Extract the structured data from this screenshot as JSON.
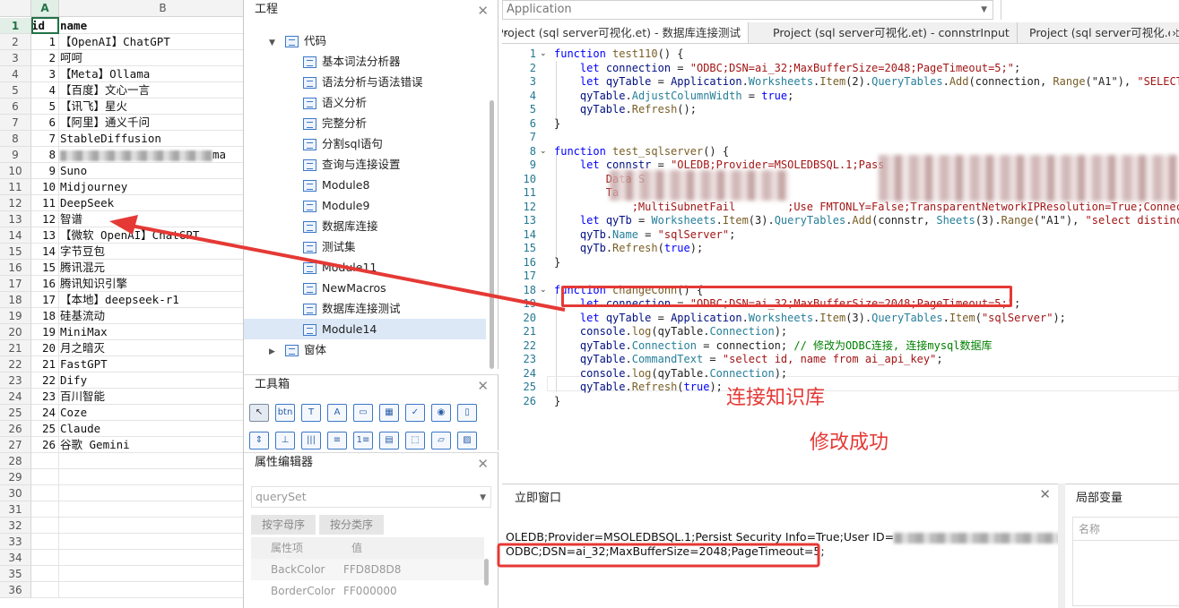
{
  "sheet": {
    "columns": [
      "A",
      "B"
    ],
    "header": {
      "id": "id",
      "name": "name"
    },
    "rows": [
      {
        "id": "1",
        "name": "【OpenAI】ChatGPT"
      },
      {
        "id": "2",
        "name": "呵呵"
      },
      {
        "id": "3",
        "name": "【Meta】Ollama"
      },
      {
        "id": "4",
        "name": "【百度】文心一言"
      },
      {
        "id": "5",
        "name": "【讯飞】星火"
      },
      {
        "id": "6",
        "name": "【阿里】通义千问"
      },
      {
        "id": "7",
        "name": "StableDiffusion"
      },
      {
        "id": "8",
        "name": "ma"
      },
      {
        "id": "9",
        "name": "Suno"
      },
      {
        "id": "10",
        "name": "Midjourney"
      },
      {
        "id": "11",
        "name": "DeepSeek"
      },
      {
        "id": "12",
        "name": "智谱"
      },
      {
        "id": "13",
        "name": "【微软 OpenAI】ChatGPT"
      },
      {
        "id": "14",
        "name": "字节豆包"
      },
      {
        "id": "15",
        "name": "腾讯混元"
      },
      {
        "id": "16",
        "name": "腾讯知识引擎"
      },
      {
        "id": "17",
        "name": "【本地】deepseek-r1"
      },
      {
        "id": "18",
        "name": "硅基流动"
      },
      {
        "id": "19",
        "name": "MiniMax"
      },
      {
        "id": "20",
        "name": "月之暗灭"
      },
      {
        "id": "21",
        "name": "FastGPT"
      },
      {
        "id": "22",
        "name": "Dify"
      },
      {
        "id": "23",
        "name": "百川智能"
      },
      {
        "id": "24",
        "name": "Coze"
      },
      {
        "id": "25",
        "name": "Claude"
      },
      {
        "id": "26",
        "name": "谷歌 Gemini"
      }
    ],
    "row_numbers": [
      "1",
      "2",
      "3",
      "4",
      "5",
      "6",
      "7",
      "8",
      "9",
      "10",
      "11",
      "12",
      "13",
      "14",
      "15",
      "16",
      "17",
      "18",
      "19",
      "20",
      "21",
      "22",
      "23",
      "24",
      "25",
      "26",
      "27",
      "28",
      "29",
      "30",
      "31",
      "32",
      "33",
      "34",
      "35",
      "36"
    ]
  },
  "project": {
    "title": "工程",
    "close": "✕",
    "items": [
      {
        "label": "代码",
        "kind": "folder-open"
      },
      {
        "label": "基本词法分析器",
        "kind": "module"
      },
      {
        "label": "语法分析与语法错误",
        "kind": "module"
      },
      {
        "label": "语义分析",
        "kind": "module"
      },
      {
        "label": "完整分析",
        "kind": "module"
      },
      {
        "label": "分割sql语句",
        "kind": "module"
      },
      {
        "label": "查询与连接设置",
        "kind": "module"
      },
      {
        "label": "Module8",
        "kind": "module"
      },
      {
        "label": "Module9",
        "kind": "module"
      },
      {
        "label": "数据库连接",
        "kind": "module"
      },
      {
        "label": "测试集",
        "kind": "module"
      },
      {
        "label": "Module11",
        "kind": "module"
      },
      {
        "label": "NewMacros",
        "kind": "module"
      },
      {
        "label": "数据库连接测试",
        "kind": "module"
      },
      {
        "label": "Module14",
        "kind": "module",
        "active": true
      },
      {
        "label": "窗体",
        "kind": "folder-closed"
      }
    ]
  },
  "toolbox": {
    "title": "工具箱",
    "close": "✕",
    "tools": [
      {
        "name": "pointer-icon",
        "glyph": "↖"
      },
      {
        "name": "button-tool-icon",
        "glyph": "btn"
      },
      {
        "name": "text-tool-icon",
        "glyph": "T"
      },
      {
        "name": "label-tool-icon",
        "glyph": "A"
      },
      {
        "name": "frame-tool-icon",
        "glyph": "▭"
      },
      {
        "name": "grid-tool-icon",
        "glyph": "▦"
      },
      {
        "name": "checkbox-tool-icon",
        "glyph": "✓"
      },
      {
        "name": "radio-tool-icon",
        "glyph": "◉"
      },
      {
        "name": "scrollbar-tool-icon",
        "glyph": "▯"
      },
      {
        "name": "spin-tool-icon",
        "glyph": "⇕"
      },
      {
        "name": "slider-tool-icon",
        "glyph": "⊥"
      },
      {
        "name": "barcode-tool-icon",
        "glyph": "|||"
      },
      {
        "name": "list-tool-icon",
        "glyph": "≡"
      },
      {
        "name": "number-list-tool-icon",
        "glyph": "1≡"
      },
      {
        "name": "tabstrip-tool-icon",
        "glyph": "▤"
      },
      {
        "name": "dotted-frame-tool-icon",
        "glyph": "⬚"
      },
      {
        "name": "folder-tool-icon",
        "glyph": "▱"
      },
      {
        "name": "image-tool-icon",
        "glyph": "▨"
      }
    ]
  },
  "properties": {
    "title": "属性编辑器",
    "close": "✕",
    "object": "querySet",
    "tab_alpha": "按字母序",
    "tab_category": "按分类序",
    "col_name": "属性项",
    "col_value": "值",
    "rows": [
      {
        "name": "BackColor",
        "value": "FFD8D8D8"
      },
      {
        "name": "BorderColor",
        "value": "FF000000"
      }
    ]
  },
  "app_combo": "Application",
  "doc_tabs": [
    "Project (sql server可视化.et) - 数据库连接测试",
    "Project (sql server可视化.et) - connstrInput",
    "Project (sql server可视化.et) - "
  ],
  "code_lines": [
    {
      "n": "1",
      "fold": "v",
      "t": [
        [
          "kw",
          "function "
        ],
        [
          "fn",
          "test110"
        ],
        [
          "",
          "() {"
        ]
      ]
    },
    {
      "n": "2",
      "t": [
        [
          "",
          "    "
        ],
        [
          "kw",
          "let "
        ],
        [
          "id",
          "connection"
        ],
        [
          "",
          " = "
        ],
        [
          "str",
          "\"ODBC;DSN=ai_32;MaxBufferSize=2048;PageTimeout=5;\""
        ],
        [
          "",
          ";"
        ]
      ]
    },
    {
      "n": "3",
      "t": [
        [
          "",
          "    "
        ],
        [
          "kw",
          "let "
        ],
        [
          "id",
          "qyTable"
        ],
        [
          "",
          " = "
        ],
        [
          "id",
          "Application"
        ],
        [
          "",
          "."
        ],
        [
          "pr",
          "Worksheets"
        ],
        [
          "",
          "."
        ],
        [
          "fn",
          "Item"
        ],
        [
          "",
          "(2)."
        ],
        [
          "pr",
          "QueryTables"
        ],
        [
          "",
          "."
        ],
        [
          "fn",
          "Add"
        ],
        [
          "",
          "(connection, "
        ],
        [
          "fn",
          "Range"
        ],
        [
          "",
          "(\"A1\"), "
        ],
        [
          "str",
          "\"SELECT 25"
        ]
      ]
    },
    {
      "n": "4",
      "t": [
        [
          "",
          "    "
        ],
        [
          "id",
          "qyTable"
        ],
        [
          "",
          "."
        ],
        [
          "pr",
          "AdjustColumnWidth"
        ],
        [
          "",
          " = "
        ],
        [
          "kw",
          "true"
        ],
        [
          "",
          ";"
        ]
      ]
    },
    {
      "n": "5",
      "t": [
        [
          "",
          "    "
        ],
        [
          "id",
          "qyTable"
        ],
        [
          "",
          "."
        ],
        [
          "fn",
          "Refresh"
        ],
        [
          "",
          "();"
        ]
      ]
    },
    {
      "n": "6",
      "t": [
        [
          "",
          "}"
        ]
      ]
    },
    {
      "n": "7",
      "t": []
    },
    {
      "n": "8",
      "fold": "v",
      "t": [
        [
          "kw",
          "function "
        ],
        [
          "fn",
          "test_sqlserver"
        ],
        [
          "",
          "() {"
        ]
      ]
    },
    {
      "n": "9",
      "t": [
        [
          "",
          "    "
        ],
        [
          "kw",
          "let "
        ],
        [
          "id",
          "connstr"
        ],
        [
          "",
          " = "
        ],
        [
          "str",
          "\"OLEDB;Provider=MSOLEDBSQL.1;Pass"
        ]
      ]
    },
    {
      "n": "10",
      "t": [
        [
          "",
          "        "
        ],
        [
          "str",
          "Data S"
        ]
      ]
    },
    {
      "n": "11",
      "t": [
        [
          "",
          "        "
        ],
        [
          "str",
          "Ta"
        ]
      ]
    },
    {
      "n": "12",
      "t": [
        [
          "",
          "            "
        ],
        [
          "str",
          ";MultiSubnetFail"
        ],
        [
          "str",
          "        ;Use FMTONLY=False;TransparentNetworkIPResolution=True;Connect"
        ]
      ]
    },
    {
      "n": "13",
      "t": [
        [
          "",
          "    "
        ],
        [
          "kw",
          "let "
        ],
        [
          "id",
          "qyTb"
        ],
        [
          "",
          " = "
        ],
        [
          "pr",
          "Worksheets"
        ],
        [
          "",
          "."
        ],
        [
          "fn",
          "Item"
        ],
        [
          "",
          "(3)."
        ],
        [
          "pr",
          "QueryTables"
        ],
        [
          "",
          "."
        ],
        [
          "fn",
          "Add"
        ],
        [
          "",
          "(connstr, "
        ],
        [
          "pr",
          "Sheets"
        ],
        [
          "",
          "(3)."
        ],
        [
          "fn",
          "Range"
        ],
        [
          "",
          "(\"A1\"), "
        ],
        [
          "str",
          "\"select distinct s"
        ]
      ]
    },
    {
      "n": "14",
      "t": [
        [
          "",
          "    "
        ],
        [
          "id",
          "qyTb"
        ],
        [
          "",
          "."
        ],
        [
          "pr",
          "Name"
        ],
        [
          "",
          " = "
        ],
        [
          "str",
          "\"sqlServer\""
        ],
        [
          "",
          ";"
        ]
      ]
    },
    {
      "n": "15",
      "t": [
        [
          "",
          "    "
        ],
        [
          "id",
          "qyTb"
        ],
        [
          "",
          "."
        ],
        [
          "fn",
          "Refresh"
        ],
        [
          "",
          "("
        ],
        [
          "kw",
          "true"
        ],
        [
          "",
          ");"
        ]
      ]
    },
    {
      "n": "16",
      "t": [
        [
          "",
          "}"
        ]
      ]
    },
    {
      "n": "17",
      "t": []
    },
    {
      "n": "18",
      "fold": "v",
      "t": [
        [
          "kw",
          "function "
        ],
        [
          "fn",
          "changeConn"
        ],
        [
          "",
          "() {"
        ]
      ]
    },
    {
      "n": "19",
      "t": [
        [
          "",
          "    "
        ],
        [
          "kw",
          "let "
        ],
        [
          "id",
          "connection"
        ],
        [
          "",
          " = "
        ],
        [
          "str",
          "\"ODBC;DSN=ai_32;MaxBufferSize=2048;PageTimeout=5;\""
        ],
        [
          "",
          ";"
        ]
      ]
    },
    {
      "n": "20",
      "t": [
        [
          "",
          "    "
        ],
        [
          "kw",
          "let "
        ],
        [
          "id",
          "qyTable"
        ],
        [
          "",
          " = "
        ],
        [
          "id",
          "Application"
        ],
        [
          "",
          "."
        ],
        [
          "pr",
          "Worksheets"
        ],
        [
          "",
          "."
        ],
        [
          "fn",
          "Item"
        ],
        [
          "",
          "(3)."
        ],
        [
          "pr",
          "QueryTables"
        ],
        [
          "",
          "."
        ],
        [
          "fn",
          "Item"
        ],
        [
          "",
          "("
        ],
        [
          "str",
          "\"sqlServer\""
        ],
        [
          "",
          ");"
        ]
      ]
    },
    {
      "n": "21",
      "t": [
        [
          "",
          "    "
        ],
        [
          "id",
          "console"
        ],
        [
          "",
          "."
        ],
        [
          "fn",
          "log"
        ],
        [
          "",
          "(qyTable."
        ],
        [
          "pr",
          "Connection"
        ],
        [
          "",
          ");"
        ]
      ]
    },
    {
      "n": "22",
      "t": [
        [
          "",
          "    "
        ],
        [
          "id",
          "qyTable"
        ],
        [
          "",
          "."
        ],
        [
          "pr",
          "Connection"
        ],
        [
          "",
          " = connection; "
        ],
        [
          "cm",
          "// 修改为ODBC连接, 连接mysql数据库"
        ]
      ]
    },
    {
      "n": "23",
      "t": [
        [
          "",
          "    "
        ],
        [
          "id",
          "qyTable"
        ],
        [
          "",
          "."
        ],
        [
          "pr",
          "CommandText"
        ],
        [
          "",
          " = "
        ],
        [
          "str",
          "\"select id, name from ai_api_key\""
        ],
        [
          "",
          ";"
        ]
      ]
    },
    {
      "n": "24",
      "t": [
        [
          "",
          "    "
        ],
        [
          "id",
          "console"
        ],
        [
          "",
          "."
        ],
        [
          "fn",
          "log"
        ],
        [
          "",
          "(qyTable."
        ],
        [
          "pr",
          "Connection"
        ],
        [
          "",
          ");"
        ]
      ]
    },
    {
      "n": "25",
      "t": [
        [
          "",
          "    "
        ],
        [
          "id",
          "qyTable"
        ],
        [
          "",
          "."
        ],
        [
          "fn",
          "Refresh"
        ],
        [
          "",
          "("
        ],
        [
          "kw",
          "true"
        ],
        [
          "",
          ");"
        ]
      ]
    },
    {
      "n": "26",
      "t": [
        [
          "",
          "}"
        ]
      ]
    }
  ],
  "annotations": {
    "connect": "连接知识库",
    "success": "修改成功",
    "color": "#e53935"
  },
  "immediate": {
    "title": "立即窗口",
    "close": "✕",
    "line1": "OLEDB;Provider=MSOLEDBSQL.1;Persist Security Info=True;User ID=",
    "line2": "ODBC;DSN=ai_32;MaxBufferSize=2048;PageTimeout=5;"
  },
  "locals": {
    "title": "局部变量",
    "col_name": "名称"
  }
}
